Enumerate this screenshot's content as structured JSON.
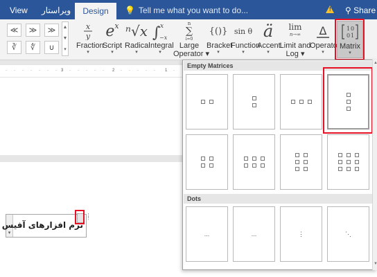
{
  "tabs": {
    "view": "View",
    "arabic": "ویراستار",
    "design": "Design",
    "tellme": "Tell me what you want to do...",
    "share": "Share"
  },
  "symbols": [
    "≪",
    "≫",
    "≫",
    "∛",
    "∜",
    "∪"
  ],
  "ribbon": {
    "fraction": "Fraction",
    "script": "Script",
    "radical": "Radical",
    "integral": "Integral",
    "large_operator_1": "Large",
    "large_operator_2": "Operator",
    "bracket": "Bracket",
    "function": "Function",
    "accent": "Accent",
    "limit_1": "Limit and",
    "limit_2": "Log",
    "operator": "Operator",
    "matrix": "Matrix",
    "func_glyph": "sin θ",
    "limit_glyph_top": "lim",
    "limit_glyph_bottom": "n→∞",
    "bracket_glyph": "{()}",
    "integral_glyph_x1": "x",
    "integral_glyph_x2": "−x",
    "largeop_top": "n",
    "largeop_bottom": "i=0",
    "script_glyph": "e",
    "script_sup": "x",
    "radical_glyph": "ⁿ√x",
    "accent_glyph": "ä",
    "matrix_glyph": "[1 0 / 0 1]"
  },
  "panel": {
    "section_empty": "Empty Matrices",
    "section_dots": "Dots",
    "dots": [
      "...",
      "...",
      "⋮",
      "⋱"
    ]
  },
  "document": {
    "equation_text": "نرم افزارهای آفیس"
  },
  "colors": {
    "accent": "#2b579a",
    "highlight": "#e81123"
  }
}
